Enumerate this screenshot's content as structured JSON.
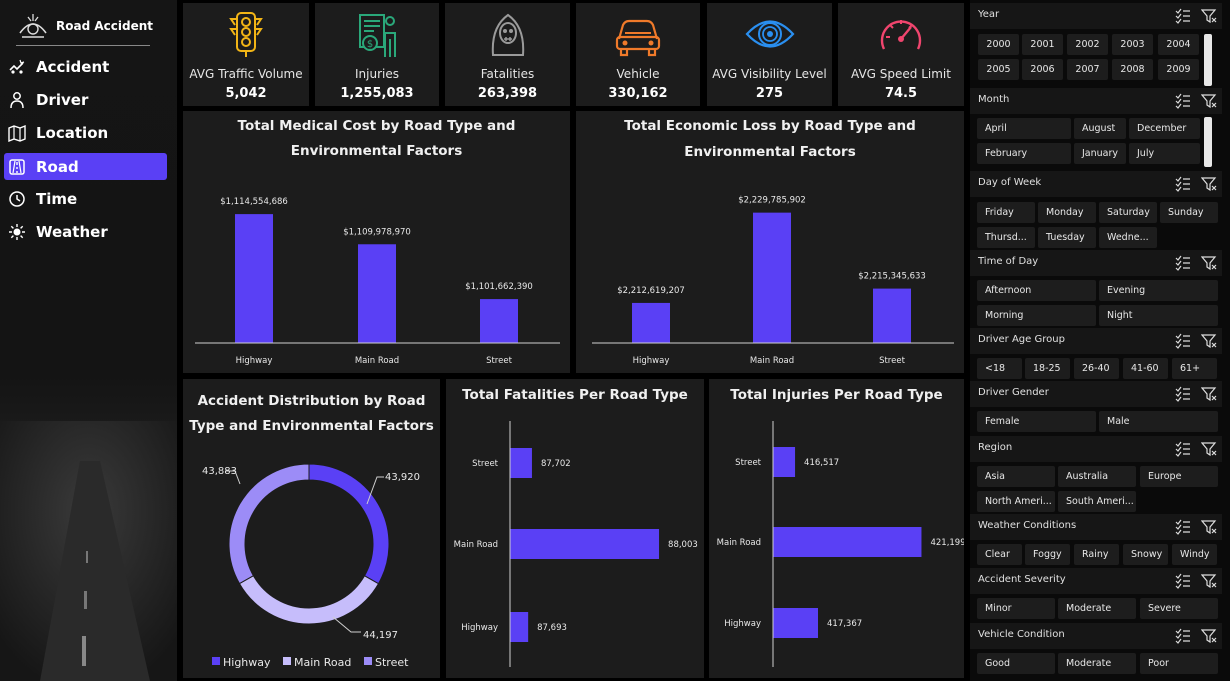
{
  "brand": {
    "name": "Road Accident"
  },
  "nav": [
    {
      "label": "Accident",
      "icon": "accident-icon",
      "active": false
    },
    {
      "label": "Driver",
      "icon": "driver-icon",
      "active": false
    },
    {
      "label": "Location",
      "icon": "map-icon",
      "active": false
    },
    {
      "label": "Road",
      "icon": "road-icon",
      "active": true
    },
    {
      "label": "Time",
      "icon": "clock-icon",
      "active": false
    },
    {
      "label": "Weather",
      "icon": "sun-icon",
      "active": false
    }
  ],
  "kpis": [
    {
      "label": "AVG Traffic Volume",
      "value": "5,042",
      "icon": "traffic-light-icon",
      "color": "#f2b516"
    },
    {
      "label": "Injuries",
      "value": "1,255,083",
      "icon": "insurance-claim-icon",
      "color": "#2aa87a"
    },
    {
      "label": "Fatalities",
      "value": "263,398",
      "icon": "grim-reaper-icon",
      "color": "#9a9a9a"
    },
    {
      "label": "Vehicle",
      "value": "330,162",
      "icon": "car-icon",
      "color": "#f07a2a"
    },
    {
      "label": "AVG Visibility Level",
      "value": "275",
      "icon": "eye-icon",
      "color": "#2a8ff0"
    },
    {
      "label": "AVG Speed Limit",
      "value": "74.5",
      "icon": "speedometer-icon",
      "color": "#f0456e"
    }
  ],
  "colors": {
    "primary": "#5a40f5",
    "light": "#c6bdfb",
    "medium": "#9c8cf7",
    "active_nav": "#5a40f5"
  },
  "chart_data": [
    {
      "type": "bar",
      "title_line1": "Total Medical Cost by Road Type and",
      "title_line2": "Environmental Factors",
      "categories": [
        "Highway",
        "Main Road",
        "Street"
      ],
      "values": [
        1114554686,
        1109978970,
        1101662390
      ],
      "labels": [
        "$1,114,554,686",
        "$1,109,978,970",
        "$1,101,662,390"
      ],
      "ylim": [
        1095000000,
        1117000000
      ]
    },
    {
      "type": "bar",
      "title_line1": "Total Economic Loss by Road Type and",
      "title_line2": "Environmental Factors",
      "categories": [
        "Highway",
        "Main Road",
        "Street"
      ],
      "values": [
        2212619207,
        2229785902,
        2215345633
      ],
      "labels": [
        "$2,212,619,207",
        "$2,229,785,902",
        "$2,215,345,633"
      ],
      "ylim": [
        2205000000,
        2232000000
      ]
    },
    {
      "type": "pie",
      "title_line1": "Accident Distribution by Road",
      "title_line2": "Type and Environmental Factors",
      "categories": [
        "Highway",
        "Main Road",
        "Street"
      ],
      "values": [
        43920,
        44197,
        43883
      ],
      "labels": [
        "43,920",
        "44,197",
        "43,883"
      ],
      "legend": [
        "Highway",
        "Main Road",
        "Street"
      ]
    },
    {
      "type": "bar",
      "orientation": "horizontal",
      "title": "Total Fatalities Per Road Type",
      "categories": [
        "Street",
        "Main Road",
        "Highway"
      ],
      "values": [
        87702,
        88003,
        87693
      ],
      "labels": [
        "87,702",
        "88,003",
        "87,693"
      ],
      "xlim": [
        87650,
        88010
      ]
    },
    {
      "type": "bar",
      "orientation": "horizontal",
      "title": "Total Injuries Per Road Type",
      "categories": [
        "Street",
        "Main Road",
        "Highway"
      ],
      "values": [
        416517,
        421199,
        417367
      ],
      "labels": [
        "416,517",
        "421,199",
        "417,367"
      ],
      "xlim": [
        415700,
        421700
      ]
    }
  ],
  "slicers": [
    {
      "title": "Year",
      "options": [
        "2000",
        "2001",
        "2002",
        "2003",
        "2004",
        "2005",
        "2006",
        "2007",
        "2008",
        "2009"
      ]
    },
    {
      "title": "Month",
      "options": [
        "April",
        "August",
        "December",
        "February",
        "January",
        "July"
      ]
    },
    {
      "title": "Day of Week",
      "options": [
        "Friday",
        "Monday",
        "Saturday",
        "Sunday",
        "Thursd...",
        "Tuesday",
        "Wedne..."
      ]
    },
    {
      "title": "Time of Day",
      "options": [
        "Afternoon",
        "Evening",
        "Morning",
        "Night"
      ]
    },
    {
      "title": "Driver Age Group",
      "options": [
        "<18",
        "18-25",
        "26-40",
        "41-60",
        "61+"
      ]
    },
    {
      "title": "Driver Gender",
      "options": [
        "Female",
        "Male"
      ]
    },
    {
      "title": "Region",
      "options": [
        "Asia",
        "Australia",
        "Europe",
        "North Ameri...",
        "South Ameri..."
      ]
    },
    {
      "title": "Weather Conditions",
      "options": [
        "Clear",
        "Foggy",
        "Rainy",
        "Snowy",
        "Windy"
      ]
    },
    {
      "title": "Accident Severity",
      "options": [
        "Minor",
        "Moderate",
        "Severe"
      ]
    },
    {
      "title": "Vehicle Condition",
      "options": [
        "Good",
        "Moderate",
        "Poor"
      ]
    }
  ]
}
